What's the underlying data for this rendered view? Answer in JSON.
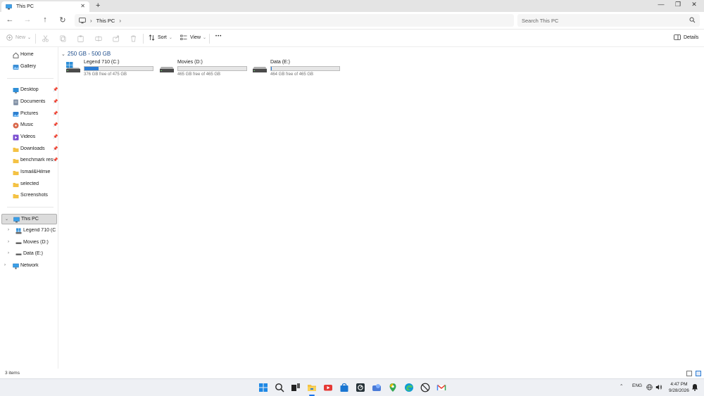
{
  "window": {
    "tab_title": "This PC",
    "tab_close": "✕",
    "new_tab": "+",
    "controls": {
      "minimize": "—",
      "maximize": "❐",
      "close": "✕"
    }
  },
  "address": {
    "crumbs": [
      "This PC"
    ],
    "separator": "›",
    "search_placeholder": "Search This PC"
  },
  "commands": {
    "new": "New",
    "sort": "Sort",
    "view": "View",
    "more": "•••",
    "details": "Details"
  },
  "sidebar": {
    "items": [
      {
        "label": "Home",
        "icon": "home-icon"
      },
      {
        "label": "Gallery",
        "icon": "gallery-icon"
      },
      {
        "label": "Desktop",
        "icon": "desktop-icon",
        "pinned": true
      },
      {
        "label": "Documents",
        "icon": "documents-icon",
        "pinned": true
      },
      {
        "label": "Pictures",
        "icon": "pictures-icon",
        "pinned": true
      },
      {
        "label": "Music",
        "icon": "music-icon",
        "pinned": true
      },
      {
        "label": "Videos",
        "icon": "videos-icon",
        "pinned": true
      },
      {
        "label": "Downloads",
        "icon": "downloads-icon",
        "pinned": true
      },
      {
        "label": "benchmark resu",
        "icon": "folder-icon",
        "pinned": true
      },
      {
        "label": "Ismail&Hilmie",
        "icon": "folder-icon"
      },
      {
        "label": "selected",
        "icon": "folder-icon"
      },
      {
        "label": "Screenshots",
        "icon": "folder-icon"
      }
    ],
    "tree": [
      {
        "label": "This PC",
        "selected": true,
        "expanded": true
      },
      {
        "label": "Legend 710 (C:)"
      },
      {
        "label": "Movies (D:)"
      },
      {
        "label": "Data (E:)"
      },
      {
        "label": "Network"
      }
    ]
  },
  "main": {
    "group_label": "250 GB - 500 GB",
    "drives": [
      {
        "name": "Legend 710 (C:)",
        "free_text": "376 GB free of 475 GB",
        "used_fraction": 0.21,
        "icon": "windows-drive-icon"
      },
      {
        "name": "Movies (D:)",
        "free_text": "465 GB free of 465 GB",
        "used_fraction": 0.0,
        "icon": "hard-drive-icon"
      },
      {
        "name": "Data (E:)",
        "free_text": "464 GB free of 465 GB",
        "used_fraction": 0.002,
        "icon": "hard-drive-icon"
      }
    ]
  },
  "status": {
    "item_count": "3 items"
  },
  "taskbar": {
    "lang": "ENG",
    "time": "4:47 PM",
    "date": "9/28/2026",
    "apps": [
      "start-icon",
      "search-icon",
      "task-view-icon",
      "file-explorer-icon",
      "youtube-icon",
      "store-icon",
      "terminal-icon",
      "app-icon",
      "maps-icon",
      "edge-icon",
      "clock-app-icon",
      "gmail-icon"
    ]
  },
  "colors": {
    "accent": "#2a7bd4",
    "folder": "#f4c244",
    "group_header": "#1f4e8c"
  }
}
